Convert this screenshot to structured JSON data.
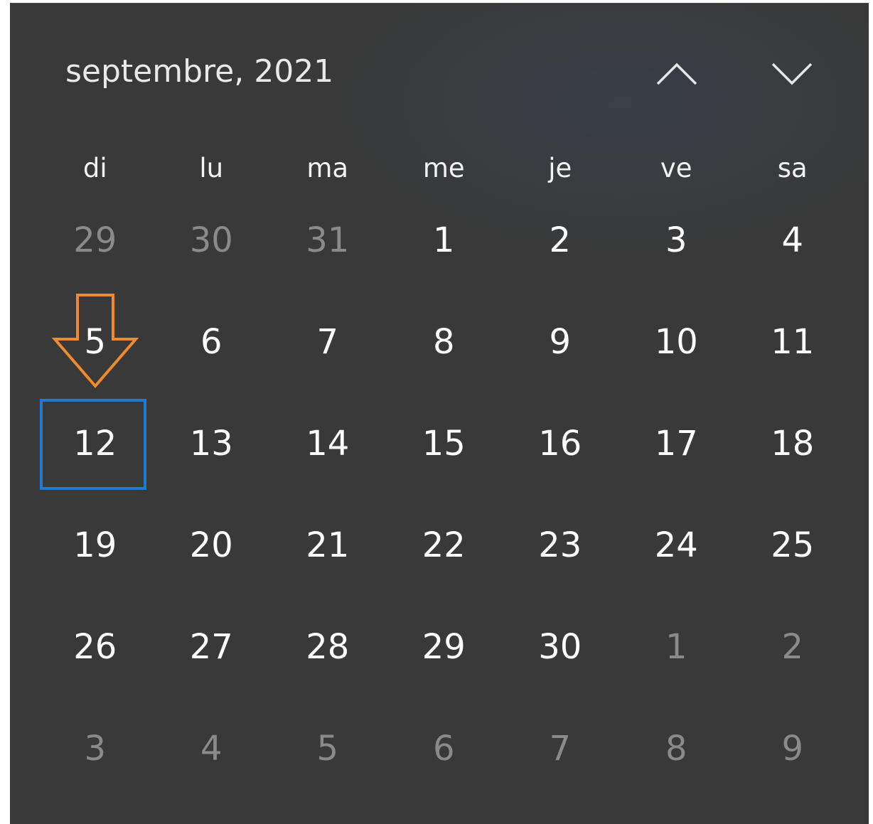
{
  "header": {
    "month_year": "septembre, 2021",
    "prev_icon": "chevron-up-icon",
    "next_icon": "chevron-down-icon"
  },
  "weekdays": [
    "di",
    "lu",
    "ma",
    "me",
    "je",
    "ve",
    "sa"
  ],
  "weeks": [
    [
      {
        "label": "29",
        "in_month": false
      },
      {
        "label": "30",
        "in_month": false
      },
      {
        "label": "31",
        "in_month": false
      },
      {
        "label": "1",
        "in_month": true
      },
      {
        "label": "2",
        "in_month": true
      },
      {
        "label": "3",
        "in_month": true
      },
      {
        "label": "4",
        "in_month": true
      }
    ],
    [
      {
        "label": "5",
        "in_month": true
      },
      {
        "label": "6",
        "in_month": true
      },
      {
        "label": "7",
        "in_month": true
      },
      {
        "label": "8",
        "in_month": true
      },
      {
        "label": "9",
        "in_month": true
      },
      {
        "label": "10",
        "in_month": true
      },
      {
        "label": "11",
        "in_month": true
      }
    ],
    [
      {
        "label": "12",
        "in_month": true
      },
      {
        "label": "13",
        "in_month": true
      },
      {
        "label": "14",
        "in_month": true
      },
      {
        "label": "15",
        "in_month": true
      },
      {
        "label": "16",
        "in_month": true
      },
      {
        "label": "17",
        "in_month": true
      },
      {
        "label": "18",
        "in_month": true
      }
    ],
    [
      {
        "label": "19",
        "in_month": true
      },
      {
        "label": "20",
        "in_month": true
      },
      {
        "label": "21",
        "in_month": true
      },
      {
        "label": "22",
        "in_month": true
      },
      {
        "label": "23",
        "in_month": true
      },
      {
        "label": "24",
        "in_month": true
      },
      {
        "label": "25",
        "in_month": true
      }
    ],
    [
      {
        "label": "26",
        "in_month": true
      },
      {
        "label": "27",
        "in_month": true
      },
      {
        "label": "28",
        "in_month": true
      },
      {
        "label": "29",
        "in_month": true
      },
      {
        "label": "30",
        "in_month": true
      },
      {
        "label": "1",
        "in_month": false
      },
      {
        "label": "2",
        "in_month": false
      }
    ],
    [
      {
        "label": "3",
        "in_month": false
      },
      {
        "label": "4",
        "in_month": false
      },
      {
        "label": "5",
        "in_month": false
      },
      {
        "label": "6",
        "in_month": false
      },
      {
        "label": "7",
        "in_month": false
      },
      {
        "label": "8",
        "in_month": false
      },
      {
        "label": "9",
        "in_month": false
      }
    ]
  ],
  "highlighted_day": "12",
  "annotation": {
    "icon": "arrow-down-icon",
    "color": "#f08a2c"
  },
  "colors": {
    "background": "#393939",
    "text": "#ffffff",
    "muted_text": "#8a8a8a",
    "focus_border": "#1f7ad4"
  }
}
